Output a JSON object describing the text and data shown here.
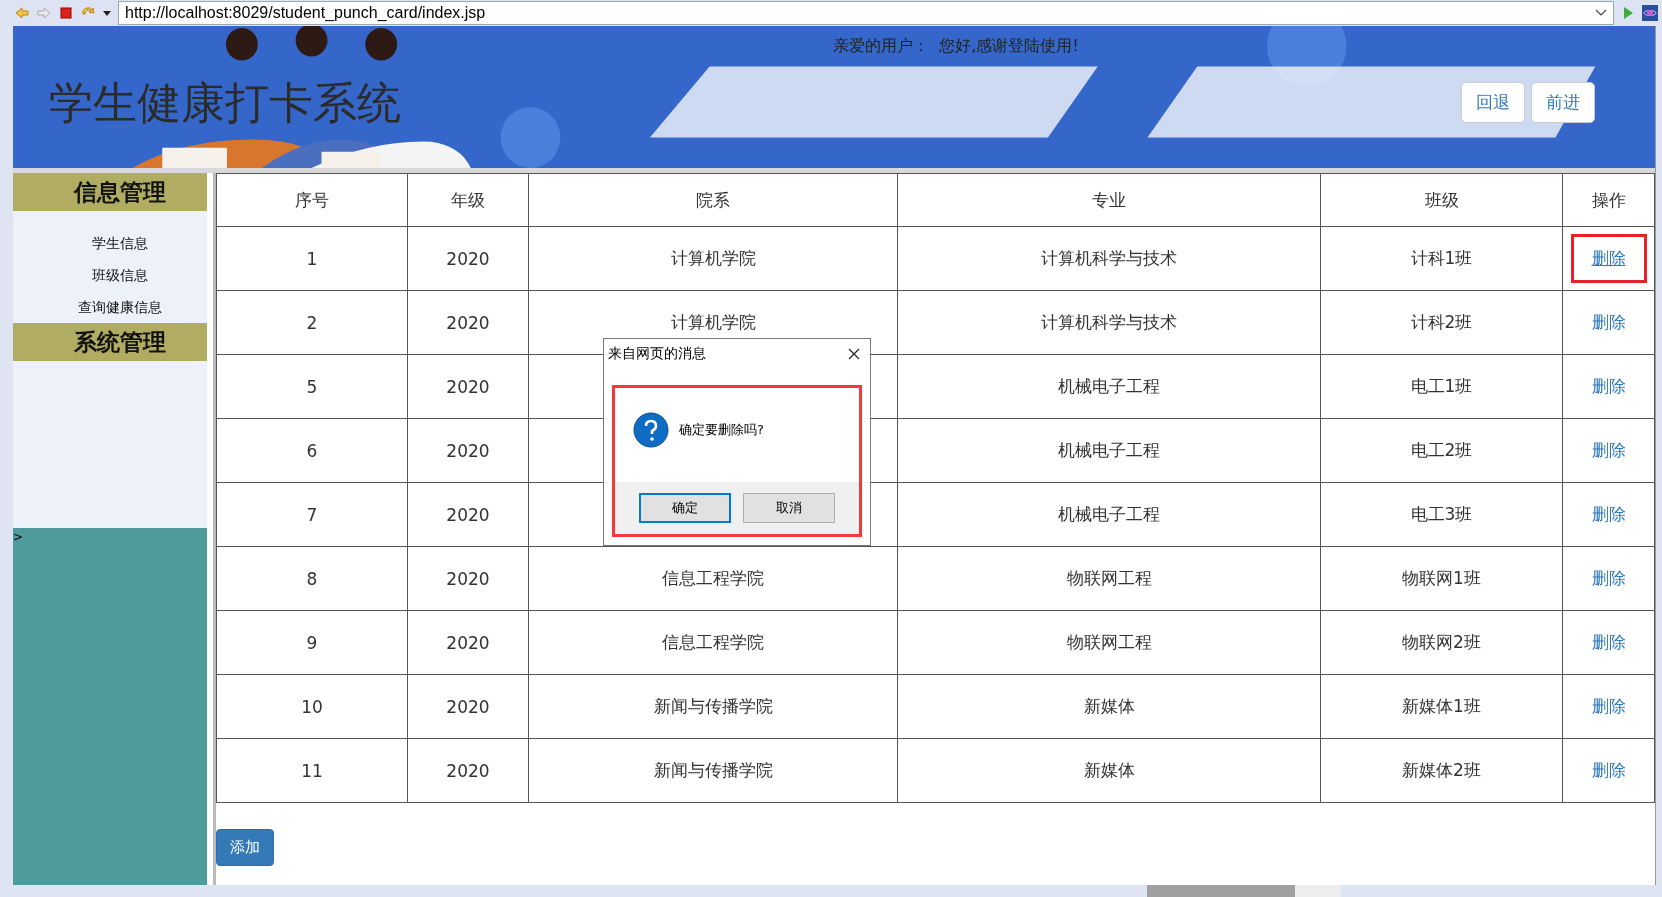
{
  "browser": {
    "address": "http://localhost:8029/student_punch_card/index.jsp"
  },
  "header": {
    "title": "学生健康打卡系统",
    "greeting": "亲爱的用户：  您好,感谢登陆使用!",
    "buttons": [
      "回退",
      "前进"
    ]
  },
  "sidebar": {
    "sections": [
      {
        "title": "信息管理",
        "items": [
          "学生信息",
          "班级信息",
          "查询健康信息"
        ]
      },
      {
        "title": "系统管理"
      }
    ],
    "footer_mark": ">"
  },
  "table": {
    "columns": [
      "序号",
      "年级",
      "院系",
      "专业",
      "班级",
      "操作"
    ],
    "rows": [
      {
        "cells": [
          "1",
          "2020",
          "计算机学院",
          "计算机科学与技术",
          "计科1班"
        ],
        "action": "删除",
        "highlighted": true
      },
      {
        "cells": [
          "2",
          "2020",
          "计算机学院",
          "计算机科学与技术",
          "计科2班"
        ],
        "action": "删除",
        "highlighted": false
      },
      {
        "cells": [
          "5",
          "2020",
          "",
          "机械电子工程",
          "电工1班"
        ],
        "action": "删除",
        "highlighted": false
      },
      {
        "cells": [
          "6",
          "2020",
          "",
          "机械电子工程",
          "电工2班"
        ],
        "action": "删除",
        "highlighted": false
      },
      {
        "cells": [
          "7",
          "2020",
          "",
          "机械电子工程",
          "电工3班"
        ],
        "action": "删除",
        "highlighted": false
      },
      {
        "cells": [
          "8",
          "2020",
          "信息工程学院",
          "物联网工程",
          "物联网1班"
        ],
        "action": "删除",
        "highlighted": false
      },
      {
        "cells": [
          "9",
          "2020",
          "信息工程学院",
          "物联网工程",
          "物联网2班"
        ],
        "action": "删除",
        "highlighted": false
      },
      {
        "cells": [
          "10",
          "2020",
          "新闻与传播学院",
          "新媒体",
          "新媒体1班"
        ],
        "action": "删除",
        "highlighted": false
      },
      {
        "cells": [
          "11",
          "2020",
          "新闻与传播学院",
          "新媒体",
          "新媒体2班"
        ],
        "action": "删除",
        "highlighted": false
      }
    ]
  },
  "add_button": "添加",
  "dialog": {
    "title": "来自网页的消息",
    "message": "确定要删除吗?",
    "buttons": [
      {
        "label": "确定",
        "selected": true
      },
      {
        "label": "取消",
        "selected": false
      }
    ],
    "highlighted": true
  }
}
